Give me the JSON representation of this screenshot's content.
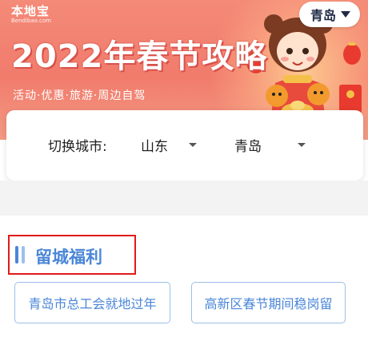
{
  "banner": {
    "logo": "本地宝",
    "logo_sub": "Bendibao.com",
    "headline": "2022年春节攻略",
    "subline": "活动·优惠·旅游·周边自驾",
    "current_city": "青岛"
  },
  "city_switch": {
    "label": "切换城市:",
    "province": "山东",
    "city": "青岛"
  },
  "section": {
    "title": "留城福利",
    "tags": [
      "青岛市总工会就地过年",
      "高新区春节期间稳岗留"
    ]
  },
  "colors": {
    "banner": "#f17b6c",
    "accent_blue": "#4a86d8",
    "highlight_red": "#e21a1a"
  }
}
